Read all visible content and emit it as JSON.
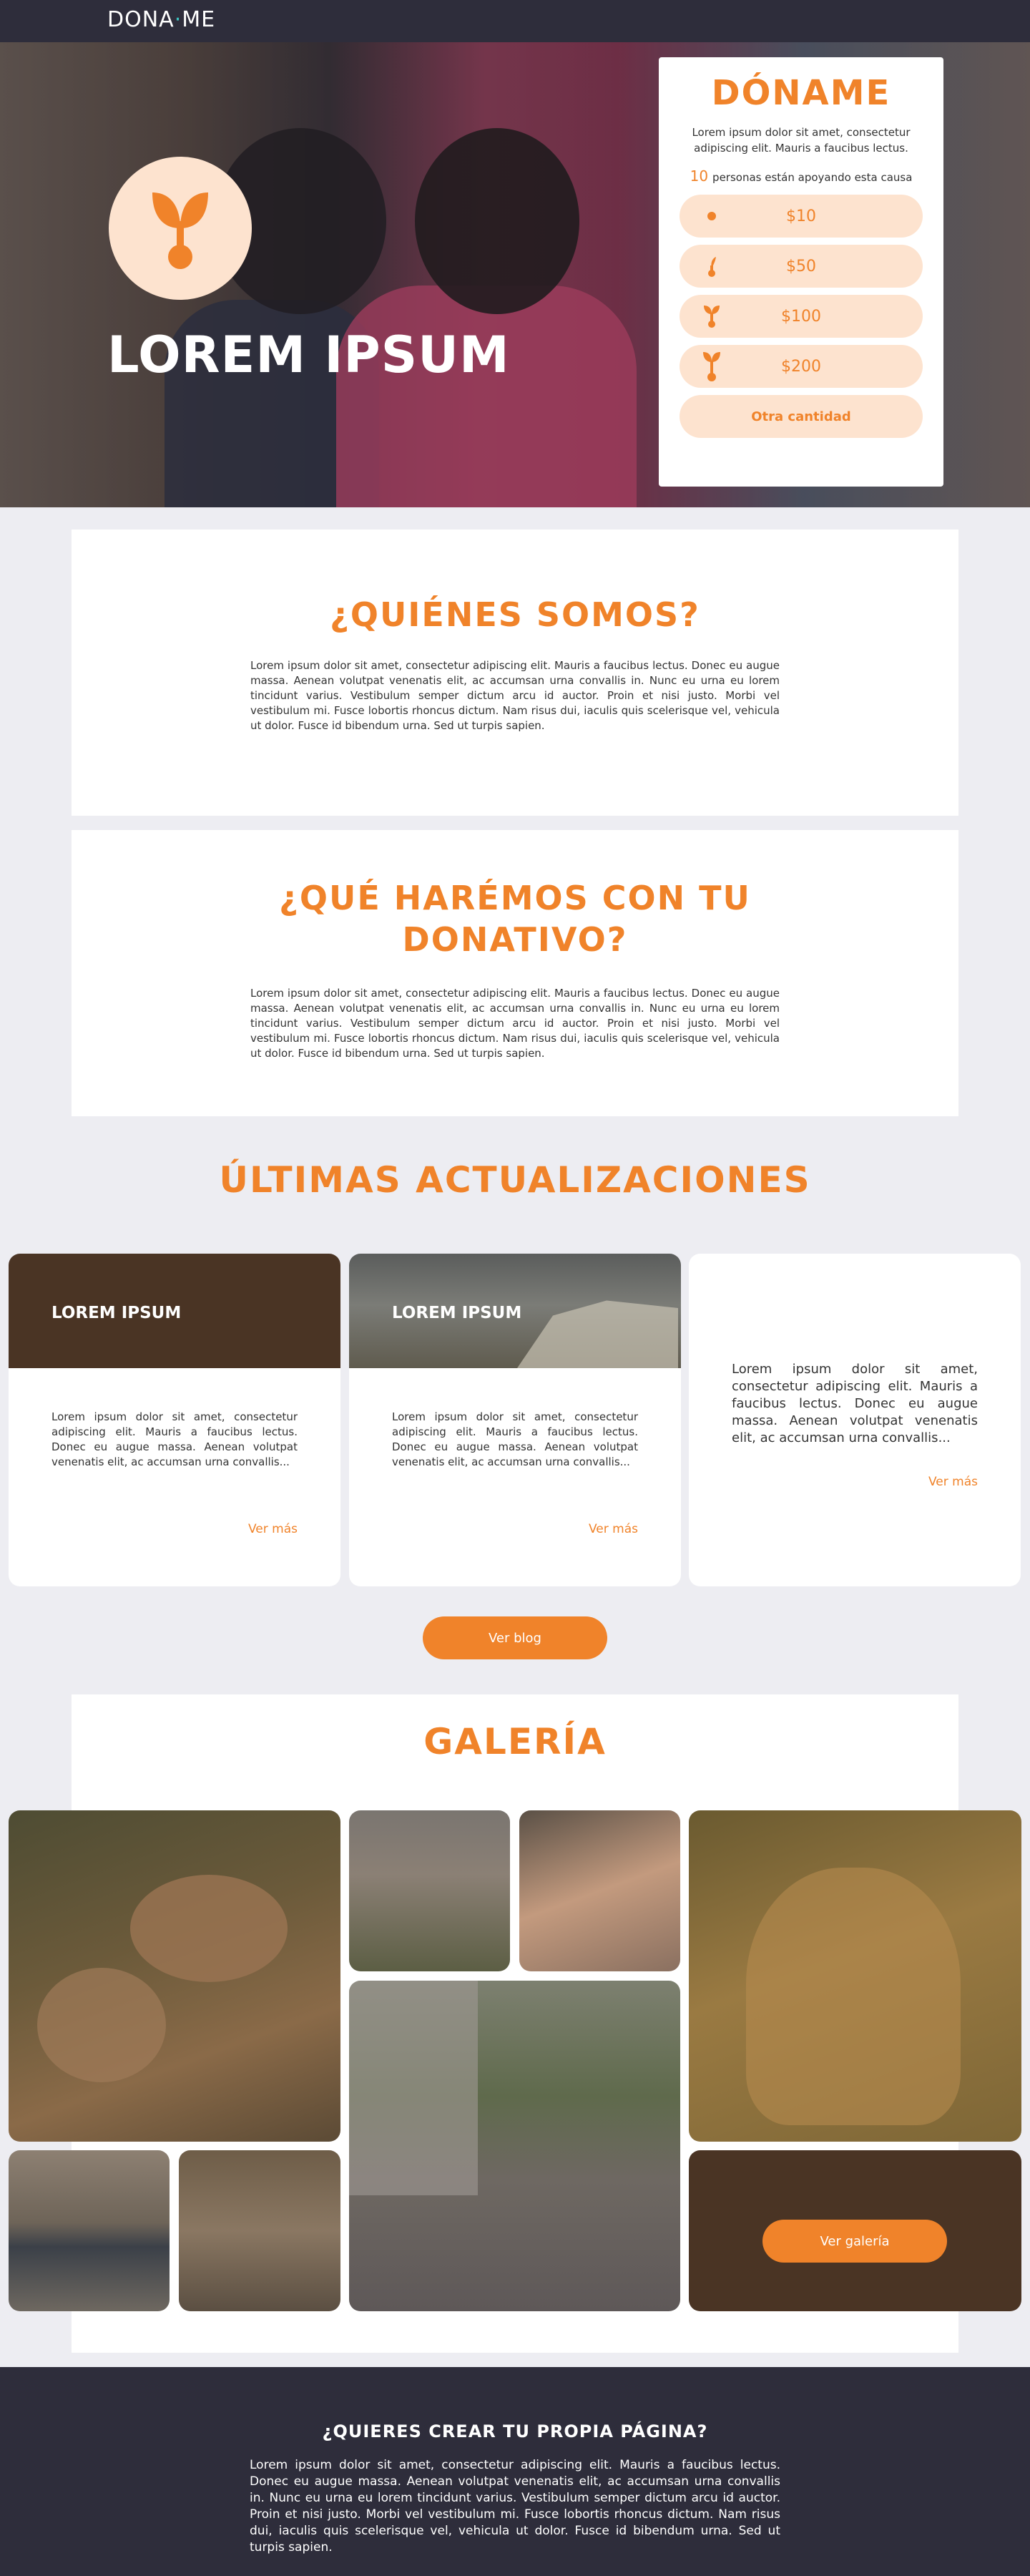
{
  "header": {
    "logo_text_left": "DONA",
    "logo_text_mid": "·",
    "logo_text_right": "ME"
  },
  "hero": {
    "title": "LOREM IPSUM"
  },
  "donate": {
    "title": "DÓNAME",
    "description": "Lorem ipsum dolor sit amet, consectetur adipiscing elit. Mauris a faucibus lectus.",
    "supporters_count": "10",
    "supporters_text": "personas están apoyando esta causa",
    "amounts": [
      {
        "label": "$10",
        "icon": "seed-icon"
      },
      {
        "label": "$50",
        "icon": "sprout-icon"
      },
      {
        "label": "$100",
        "icon": "small-plant-icon"
      },
      {
        "label": "$200",
        "icon": "plant-icon"
      }
    ],
    "other_label": "Otra cantidad"
  },
  "about": {
    "title": "¿QUIÉNES SOMOS?",
    "text": "Lorem ipsum dolor sit amet, consectetur adipiscing elit. Mauris a faucibus lectus. Donec eu augue massa. Aenean volutpat venenatis elit, ac accumsan urna convallis in. Nunc eu urna eu lorem tincidunt varius. Vestibulum semper dictum arcu id auctor. Proin et nisi justo. Morbi vel vestibulum mi. Fusce lobortis rhoncus dictum. Nam risus dui, iaculis quis scelerisque vel, vehicula ut dolor. Fusce id bibendum urna. Sed ut turpis sapien."
  },
  "plan": {
    "title_line1": "¿QUÉ HARÉMOS CON TU",
    "title_line2": "DONATIVO?",
    "text": "Lorem ipsum dolor sit amet, consectetur adipiscing elit. Mauris a faucibus lectus. Donec eu augue massa. Aenean volutpat venenatis elit, ac accumsan urna convallis in. Nunc eu urna eu lorem tincidunt varius. Vestibulum semper dictum arcu id auctor. Proin et nisi justo. Morbi vel vestibulum mi. Fusce lobortis rhoncus dictum. Nam risus dui, iaculis quis scelerisque vel, vehicula ut dolor. Fusce id bibendum urna. Sed ut turpis sapien."
  },
  "updates": {
    "title": "ÚLTIMAS ACTUALIZACIONES",
    "cards": [
      {
        "heading": "LOREM IPSUM",
        "text": "Lorem ipsum dolor sit amet, consectetur adipiscing elit. Mauris a faucibus lectus. Donec eu augue massa. Aenean volutpat venenatis elit, ac accumsan urna convallis...",
        "more": "Ver más"
      },
      {
        "heading": "LOREM IPSUM",
        "text": "Lorem ipsum dolor sit amet, consectetur adipiscing elit. Mauris a faucibus lectus. Donec eu augue massa. Aenean volutpat venenatis elit, ac accumsan urna convallis...",
        "more": "Ver más"
      },
      {
        "heading": "",
        "text": "Lorem ipsum dolor sit amet, consectetur adipiscing elit. Mauris a faucibus lectus. Donec eu augue massa. Aenean volutpat venenatis elit, ac accumsan urna convallis...",
        "more": "Ver más"
      }
    ],
    "blog_button": "Ver blog"
  },
  "gallery": {
    "title": "GALERÍA",
    "button": "Ver galería"
  },
  "footer": {
    "title": "¿QUIERES CREAR TU PROPIA PÁGINA?",
    "text": "Lorem ipsum dolor sit amet, consectetur adipiscing elit. Mauris a faucibus lectus. Donec eu augue massa. Aenean volutpat venenatis elit, ac accumsan urna convallis in. Nunc eu urna eu lorem tincidunt varius. Vestibulum semper dictum arcu id auctor. Proin et nisi justo. Morbi vel vestibulum mi. Fusce lobortis rhoncus dictum. Nam risus dui, iaculis quis scelerisque vel, vehicula ut dolor. Fusce id bibendum urna. Sed ut turpis sapien."
  },
  "colors": {
    "accent": "#f0832a",
    "accent_light": "#fde3cf",
    "dark": "#2e2d3b",
    "brown": "#4a3424",
    "teal": "#3cc3c0"
  }
}
